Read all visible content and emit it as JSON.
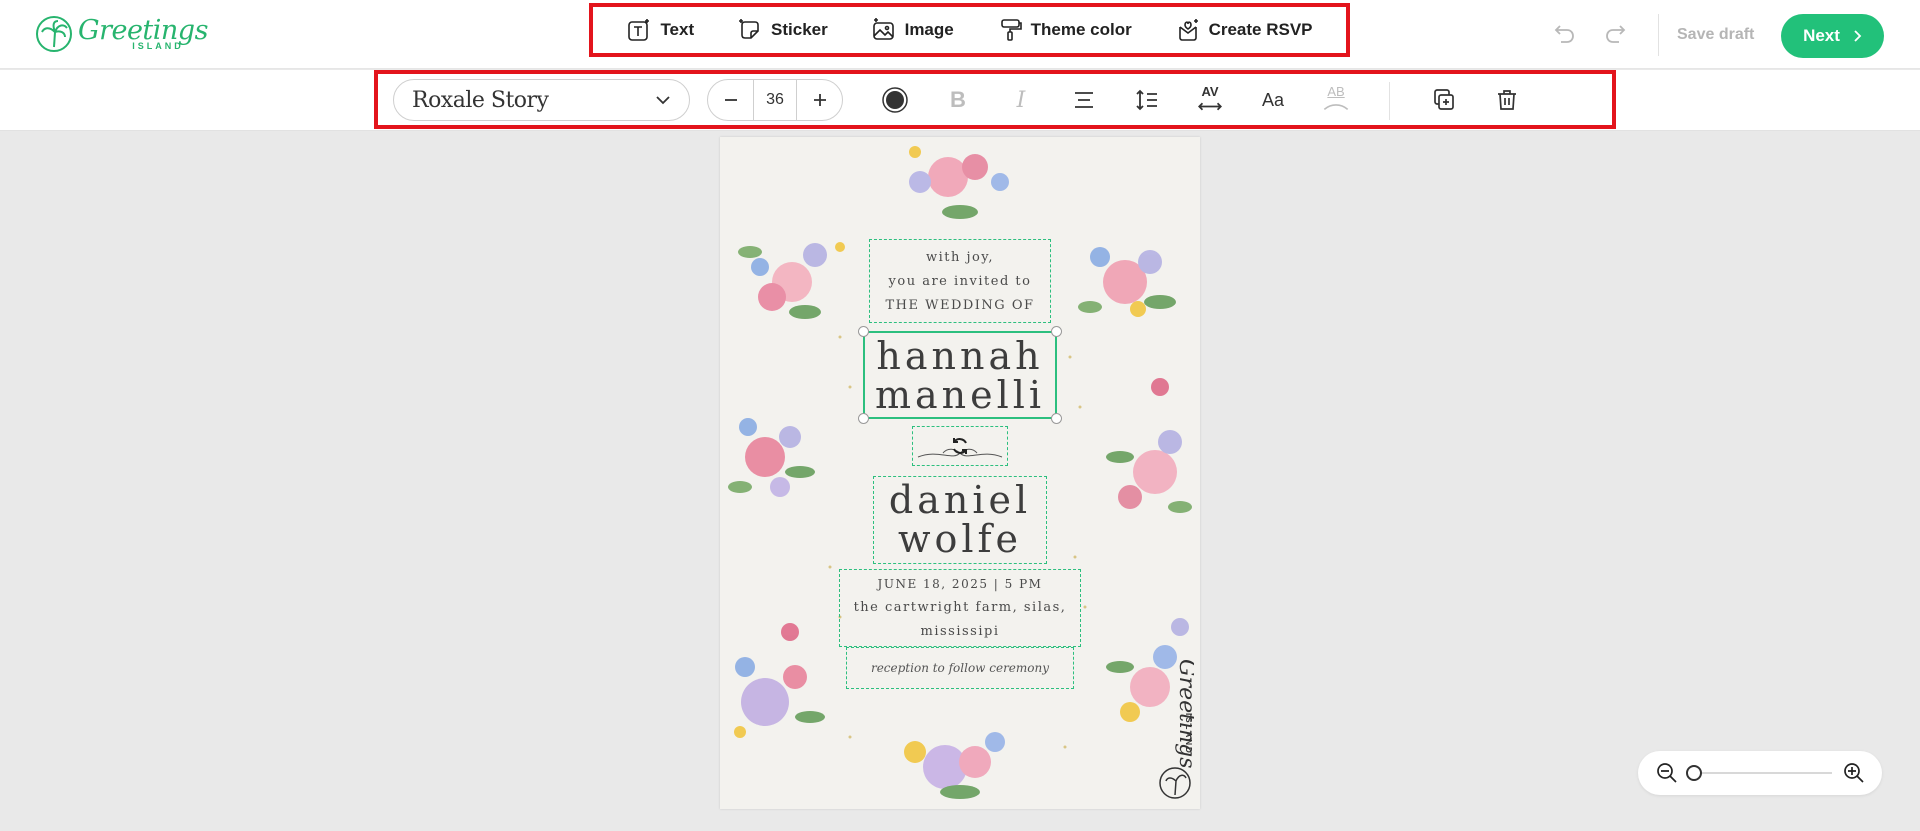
{
  "brand": {
    "name": "Greetings",
    "sub": "ISLAND",
    "color": "#27b46e"
  },
  "tools": [
    {
      "label": "Text",
      "icon": "text-icon"
    },
    {
      "label": "Sticker",
      "icon": "sticker-icon"
    },
    {
      "label": "Image",
      "icon": "image-icon"
    },
    {
      "label": "Theme color",
      "icon": "theme-color-icon"
    },
    {
      "label": "Create RSVP",
      "icon": "rsvp-icon"
    }
  ],
  "header": {
    "save_draft": "Save draft",
    "next": "Next",
    "accent": "#22c17a",
    "highlight": "#e3141c"
  },
  "format": {
    "font_name": "Roxale Story",
    "font_size": "36",
    "bold_glyph": "B",
    "italic_glyph": "I",
    "case_glyph": "Aa",
    "outline_glyph": "AB",
    "kerning_glyph": "AV"
  },
  "card": {
    "intro": [
      "with joy,",
      "you are invited to",
      "THE WEDDING OF"
    ],
    "name1": [
      "hannah",
      "manelli"
    ],
    "name2": [
      "daniel",
      "wolfe"
    ],
    "details": [
      "JUNE 18, 2025 | 5 PM",
      "the cartwright farm, silas,",
      "mississipi"
    ],
    "reception": "reception to follow ceremony",
    "watermark": "Greetings ISLAND"
  },
  "zoom": {
    "level": 0
  }
}
